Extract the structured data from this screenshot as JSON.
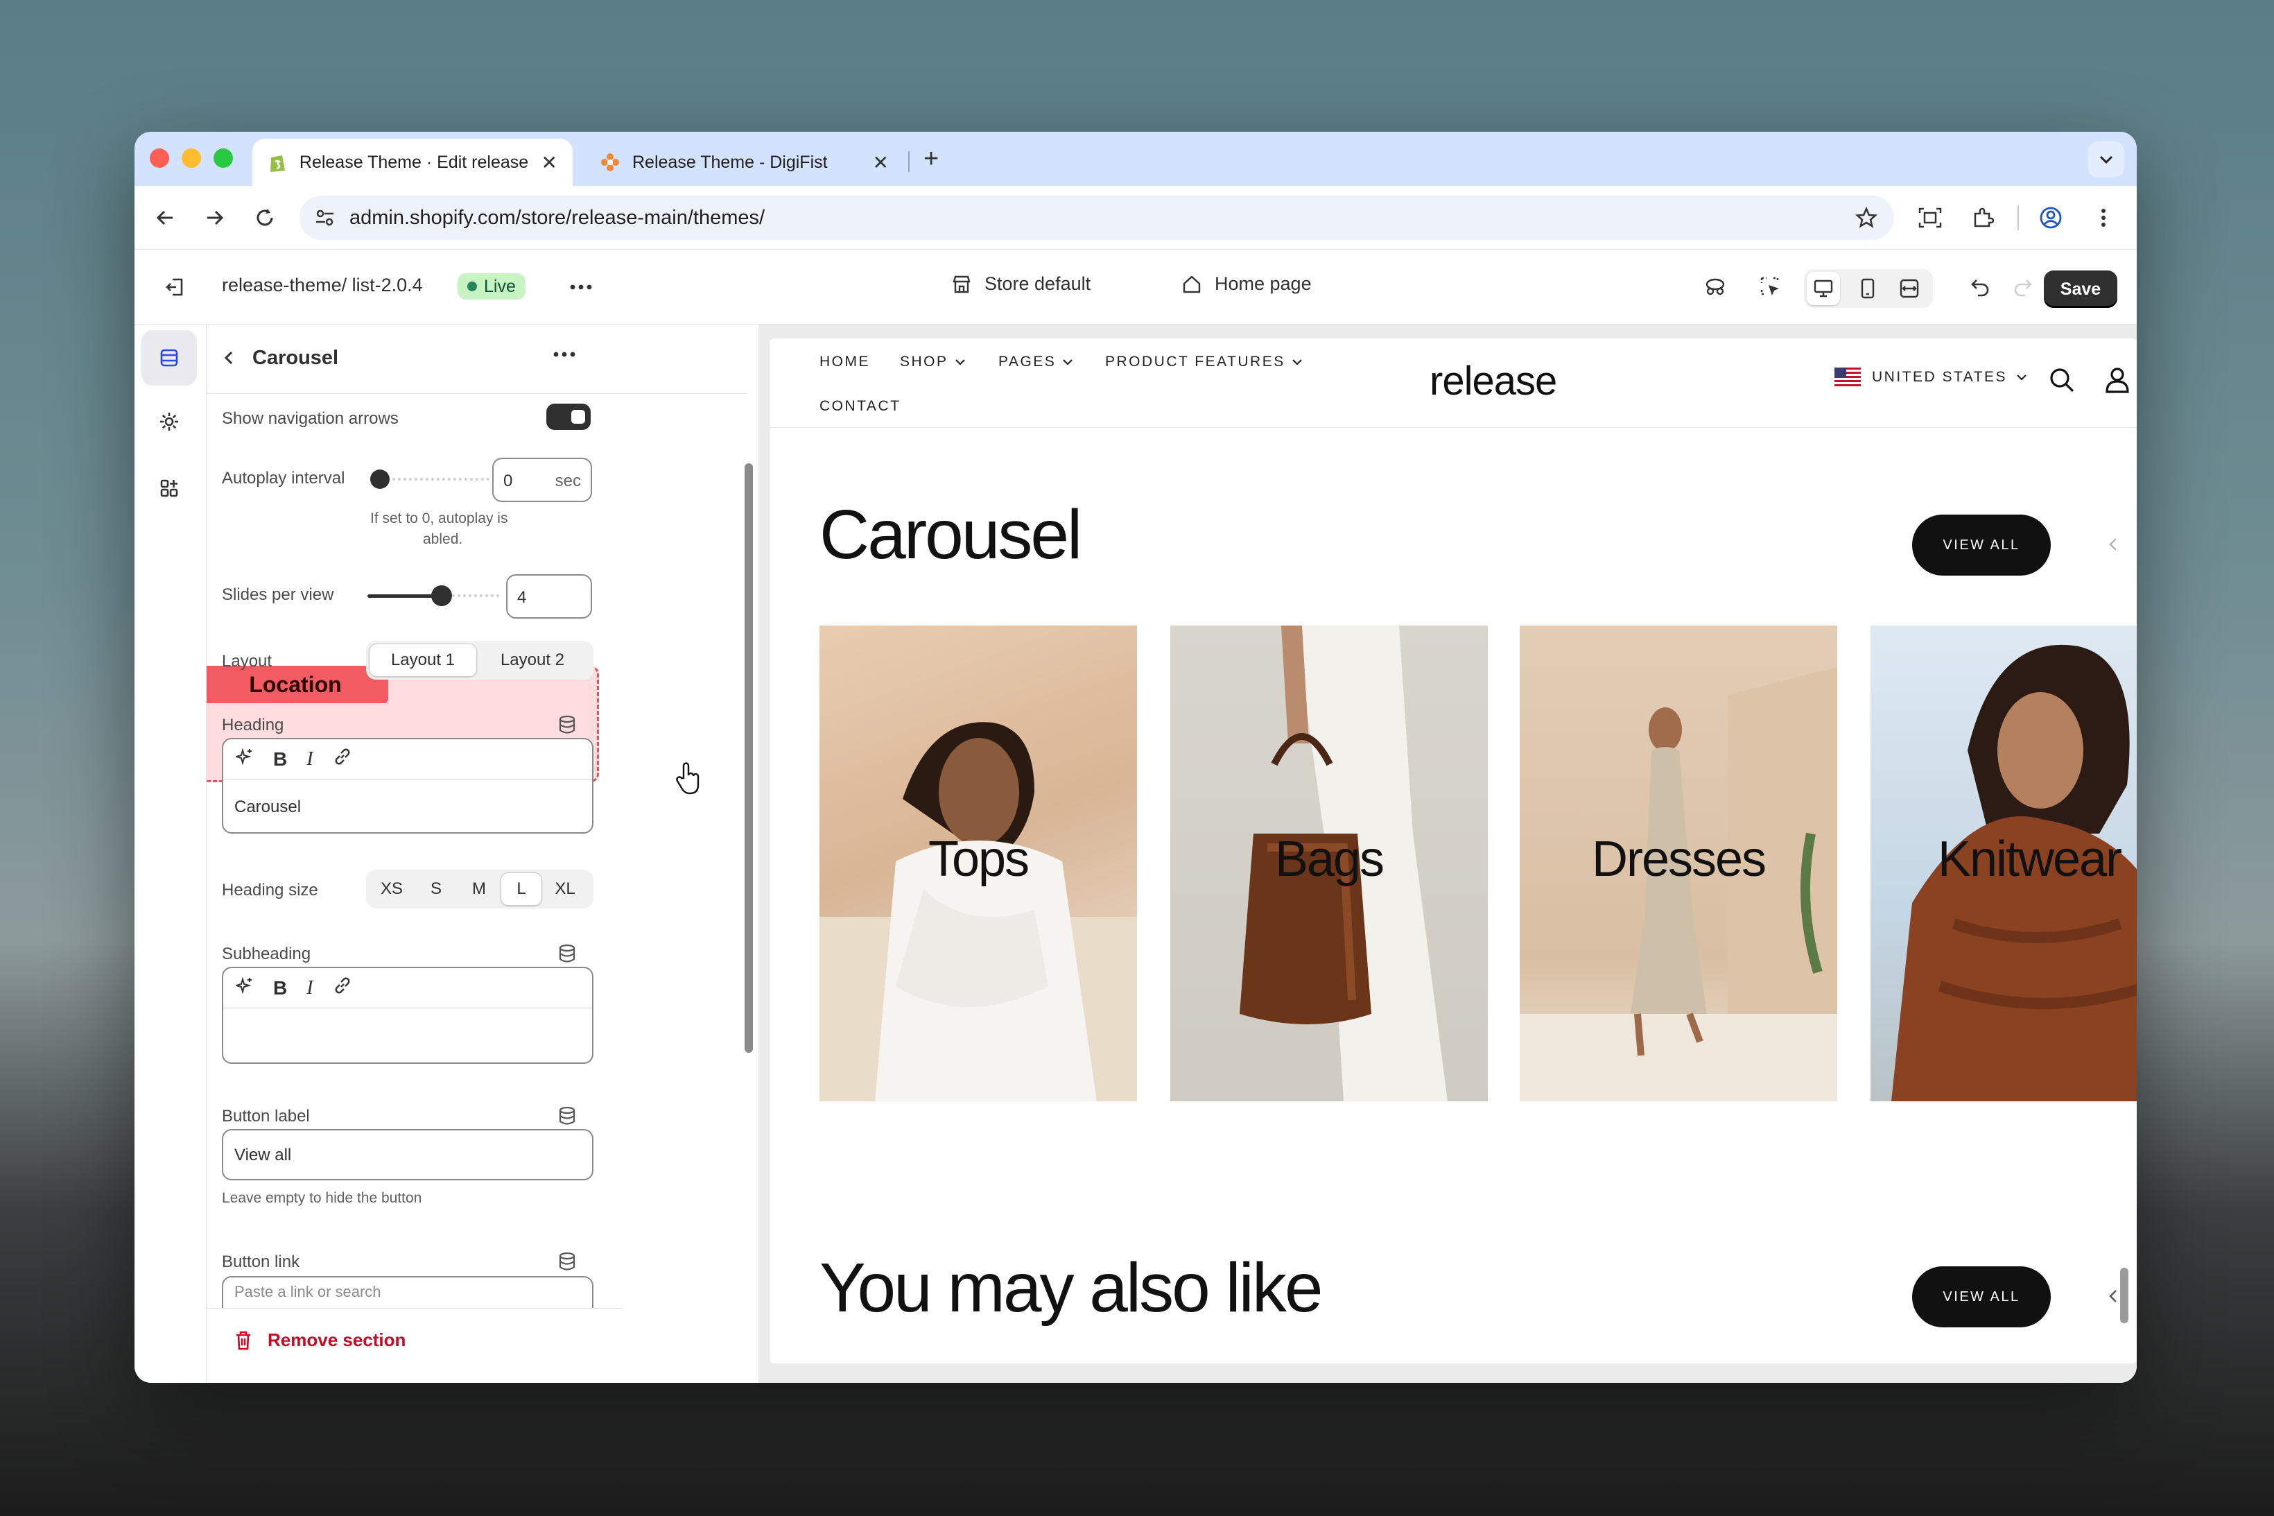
{
  "browser": {
    "tabs": [
      {
        "title": "Release Theme · Edit release",
        "active": true
      },
      {
        "title": "Release Theme - DigiFist",
        "active": false
      }
    ],
    "url": "admin.shopify.com/store/release-main/themes/"
  },
  "topbar": {
    "theme_path": "release-theme/ list-2.0.4",
    "live_badge": "Live",
    "store_label": "Store default",
    "page_label": "Home page",
    "save_label": "Save"
  },
  "panel": {
    "title": "Carousel",
    "show_arrows_label": "Show navigation arrows",
    "show_arrows_on": true,
    "autoplay_label": "Autoplay interval",
    "autoplay_value": "0",
    "autoplay_unit": "sec",
    "autoplay_help_1": "If set to 0, autoplay is",
    "autoplay_help_2": "abled.",
    "slides_label": "Slides per view",
    "slides_value": "4",
    "layout_label": "Layout",
    "layout_options": [
      "Layout 1",
      "Layout 2"
    ],
    "layout_selected": "Layout 1",
    "heading_label": "Heading",
    "heading_value": "Carousel",
    "heading_size_label": "Heading size",
    "heading_sizes": [
      "XS",
      "S",
      "M",
      "L",
      "XL"
    ],
    "heading_size_selected": "L",
    "subheading_label": "Subheading",
    "button_label_label": "Button label",
    "button_label_value": "View all",
    "button_label_help": "Leave empty to hide the button",
    "button_link_label": "Button link",
    "button_link_placeholder": "Paste a link or search",
    "remove_section": "Remove section"
  },
  "annotation": {
    "tag": "Location",
    "color": "#f25b61"
  },
  "preview": {
    "nav": [
      "HOME",
      "SHOP",
      "PAGES",
      "PRODUCT FEATURES",
      "CONTACT"
    ],
    "logo": "release",
    "country": "UNITED STATES",
    "section1_heading": "Carousel",
    "section1_button": "VIEW ALL",
    "cards": [
      "Tops",
      "Bags",
      "Dresses",
      "Knitwear"
    ],
    "section2_heading": "You may also like",
    "section2_button": "VIEW ALL"
  },
  "colors": {
    "live_green": "#29845a",
    "save_bg": "#303030",
    "accent_red": "#c70a24"
  }
}
